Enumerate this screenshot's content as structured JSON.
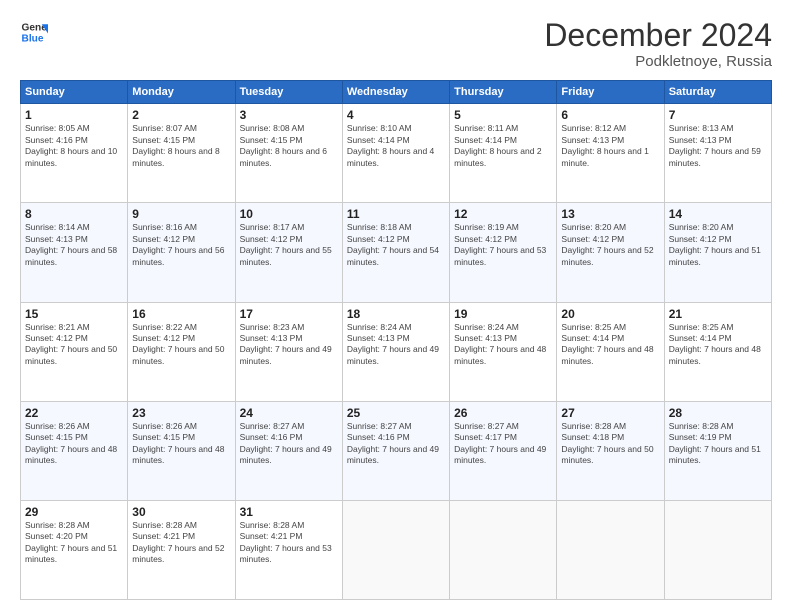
{
  "logo": {
    "line1": "General",
    "line2": "Blue"
  },
  "header": {
    "title": "December 2024",
    "subtitle": "Podkletnoye, Russia"
  },
  "weekdays": [
    "Sunday",
    "Monday",
    "Tuesday",
    "Wednesday",
    "Thursday",
    "Friday",
    "Saturday"
  ],
  "weeks": [
    [
      {
        "day": "1",
        "sunrise": "Sunrise: 8:05 AM",
        "sunset": "Sunset: 4:16 PM",
        "daylight": "Daylight: 8 hours and 10 minutes."
      },
      {
        "day": "2",
        "sunrise": "Sunrise: 8:07 AM",
        "sunset": "Sunset: 4:15 PM",
        "daylight": "Daylight: 8 hours and 8 minutes."
      },
      {
        "day": "3",
        "sunrise": "Sunrise: 8:08 AM",
        "sunset": "Sunset: 4:15 PM",
        "daylight": "Daylight: 8 hours and 6 minutes."
      },
      {
        "day": "4",
        "sunrise": "Sunrise: 8:10 AM",
        "sunset": "Sunset: 4:14 PM",
        "daylight": "Daylight: 8 hours and 4 minutes."
      },
      {
        "day": "5",
        "sunrise": "Sunrise: 8:11 AM",
        "sunset": "Sunset: 4:14 PM",
        "daylight": "Daylight: 8 hours and 2 minutes."
      },
      {
        "day": "6",
        "sunrise": "Sunrise: 8:12 AM",
        "sunset": "Sunset: 4:13 PM",
        "daylight": "Daylight: 8 hours and 1 minute."
      },
      {
        "day": "7",
        "sunrise": "Sunrise: 8:13 AM",
        "sunset": "Sunset: 4:13 PM",
        "daylight": "Daylight: 7 hours and 59 minutes."
      }
    ],
    [
      {
        "day": "8",
        "sunrise": "Sunrise: 8:14 AM",
        "sunset": "Sunset: 4:13 PM",
        "daylight": "Daylight: 7 hours and 58 minutes."
      },
      {
        "day": "9",
        "sunrise": "Sunrise: 8:16 AM",
        "sunset": "Sunset: 4:12 PM",
        "daylight": "Daylight: 7 hours and 56 minutes."
      },
      {
        "day": "10",
        "sunrise": "Sunrise: 8:17 AM",
        "sunset": "Sunset: 4:12 PM",
        "daylight": "Daylight: 7 hours and 55 minutes."
      },
      {
        "day": "11",
        "sunrise": "Sunrise: 8:18 AM",
        "sunset": "Sunset: 4:12 PM",
        "daylight": "Daylight: 7 hours and 54 minutes."
      },
      {
        "day": "12",
        "sunrise": "Sunrise: 8:19 AM",
        "sunset": "Sunset: 4:12 PM",
        "daylight": "Daylight: 7 hours and 53 minutes."
      },
      {
        "day": "13",
        "sunrise": "Sunrise: 8:20 AM",
        "sunset": "Sunset: 4:12 PM",
        "daylight": "Daylight: 7 hours and 52 minutes."
      },
      {
        "day": "14",
        "sunrise": "Sunrise: 8:20 AM",
        "sunset": "Sunset: 4:12 PM",
        "daylight": "Daylight: 7 hours and 51 minutes."
      }
    ],
    [
      {
        "day": "15",
        "sunrise": "Sunrise: 8:21 AM",
        "sunset": "Sunset: 4:12 PM",
        "daylight": "Daylight: 7 hours and 50 minutes."
      },
      {
        "day": "16",
        "sunrise": "Sunrise: 8:22 AM",
        "sunset": "Sunset: 4:12 PM",
        "daylight": "Daylight: 7 hours and 50 minutes."
      },
      {
        "day": "17",
        "sunrise": "Sunrise: 8:23 AM",
        "sunset": "Sunset: 4:13 PM",
        "daylight": "Daylight: 7 hours and 49 minutes."
      },
      {
        "day": "18",
        "sunrise": "Sunrise: 8:24 AM",
        "sunset": "Sunset: 4:13 PM",
        "daylight": "Daylight: 7 hours and 49 minutes."
      },
      {
        "day": "19",
        "sunrise": "Sunrise: 8:24 AM",
        "sunset": "Sunset: 4:13 PM",
        "daylight": "Daylight: 7 hours and 48 minutes."
      },
      {
        "day": "20",
        "sunrise": "Sunrise: 8:25 AM",
        "sunset": "Sunset: 4:14 PM",
        "daylight": "Daylight: 7 hours and 48 minutes."
      },
      {
        "day": "21",
        "sunrise": "Sunrise: 8:25 AM",
        "sunset": "Sunset: 4:14 PM",
        "daylight": "Daylight: 7 hours and 48 minutes."
      }
    ],
    [
      {
        "day": "22",
        "sunrise": "Sunrise: 8:26 AM",
        "sunset": "Sunset: 4:15 PM",
        "daylight": "Daylight: 7 hours and 48 minutes."
      },
      {
        "day": "23",
        "sunrise": "Sunrise: 8:26 AM",
        "sunset": "Sunset: 4:15 PM",
        "daylight": "Daylight: 7 hours and 48 minutes."
      },
      {
        "day": "24",
        "sunrise": "Sunrise: 8:27 AM",
        "sunset": "Sunset: 4:16 PM",
        "daylight": "Daylight: 7 hours and 49 minutes."
      },
      {
        "day": "25",
        "sunrise": "Sunrise: 8:27 AM",
        "sunset": "Sunset: 4:16 PM",
        "daylight": "Daylight: 7 hours and 49 minutes."
      },
      {
        "day": "26",
        "sunrise": "Sunrise: 8:27 AM",
        "sunset": "Sunset: 4:17 PM",
        "daylight": "Daylight: 7 hours and 49 minutes."
      },
      {
        "day": "27",
        "sunrise": "Sunrise: 8:28 AM",
        "sunset": "Sunset: 4:18 PM",
        "daylight": "Daylight: 7 hours and 50 minutes."
      },
      {
        "day": "28",
        "sunrise": "Sunrise: 8:28 AM",
        "sunset": "Sunset: 4:19 PM",
        "daylight": "Daylight: 7 hours and 51 minutes."
      }
    ],
    [
      {
        "day": "29",
        "sunrise": "Sunrise: 8:28 AM",
        "sunset": "Sunset: 4:20 PM",
        "daylight": "Daylight: 7 hours and 51 minutes."
      },
      {
        "day": "30",
        "sunrise": "Sunrise: 8:28 AM",
        "sunset": "Sunset: 4:21 PM",
        "daylight": "Daylight: 7 hours and 52 minutes."
      },
      {
        "day": "31",
        "sunrise": "Sunrise: 8:28 AM",
        "sunset": "Sunset: 4:21 PM",
        "daylight": "Daylight: 7 hours and 53 minutes."
      },
      null,
      null,
      null,
      null
    ]
  ]
}
